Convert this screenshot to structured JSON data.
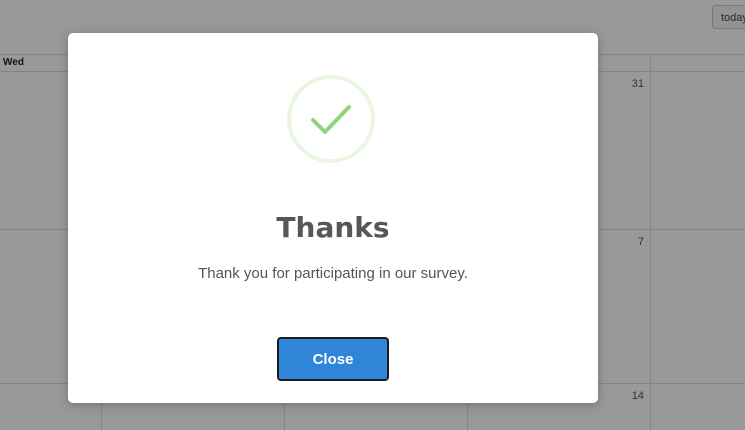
{
  "calendar": {
    "toolbar": {
      "today_label": "today"
    },
    "weekday_visible": "Wed",
    "day_numbers": [
      "31",
      "7",
      "14"
    ]
  },
  "modal": {
    "icon": "check-circle-icon",
    "title": "Thanks",
    "message": "Thank you for participating in our survey.",
    "close_label": "Close"
  },
  "colors": {
    "overlay": "rgba(0,0,0,0.4)",
    "check": "#8ed47e",
    "icon_ring": "#eaf6e4",
    "button": "#2f86d8",
    "button_border": "#1d1d1d"
  }
}
